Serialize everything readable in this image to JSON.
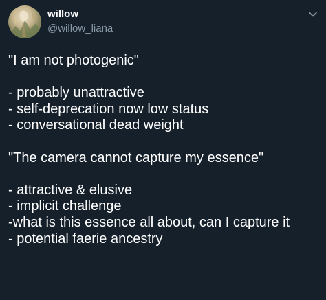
{
  "user": {
    "display_name": "willow",
    "handle": "@willow_liana",
    "avatar_icon": "avatar-photo"
  },
  "menu_icon": "chevron-down-icon",
  "tweet_lines": [
    "\"I am not photogenic\"",
    "",
    "- probably unattractive",
    "- self-deprecation now low status",
    "- conversational dead weight",
    "",
    "\"The camera cannot capture my essence\"",
    "",
    "- attractive & elusive",
    "- implicit challenge",
    "-what is this essence all about, can I capture it",
    "- potential faerie ancestry"
  ],
  "colors": {
    "background": "#15202b",
    "text": "#ffffff",
    "secondary_text": "#8899a6"
  }
}
